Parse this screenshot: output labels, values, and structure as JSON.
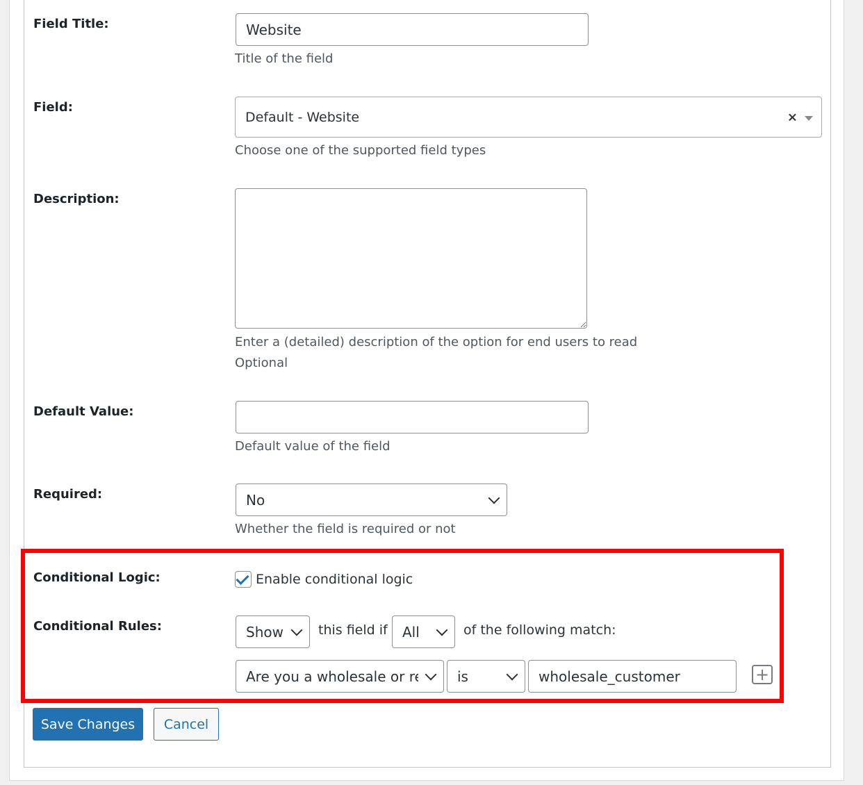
{
  "fields": {
    "field_title": {
      "label": "Field Title:",
      "value": "Website",
      "description": "Title of the field"
    },
    "field": {
      "label": "Field:",
      "value": "Default - Website",
      "description": "Choose one of the supported field types"
    },
    "description": {
      "label": "Description:",
      "value": "",
      "description_line1": "Enter a (detailed) description of the option for end users to read",
      "description_line2": "Optional"
    },
    "default_value": {
      "label": "Default Value:",
      "value": "",
      "description": "Default value of the field"
    },
    "required": {
      "label": "Required:",
      "value": "No",
      "description": "Whether the field is required or not"
    }
  },
  "conditional": {
    "logic_label": "Conditional Logic:",
    "checkbox_label": "Enable conditional logic",
    "checked": true,
    "rules_label": "Conditional Rules:",
    "action_value": "Show",
    "text_this_field_if": "this field if",
    "match_value": "All",
    "text_following_match": "of the following match:",
    "rule": {
      "question": "Are you a wholesale or ret",
      "operator": "is",
      "value": "wholesale_customer"
    }
  },
  "buttons": {
    "save": "Save Changes",
    "cancel": "Cancel"
  },
  "colors": {
    "primary": "#2271b1",
    "highlight": "#ff0000"
  }
}
